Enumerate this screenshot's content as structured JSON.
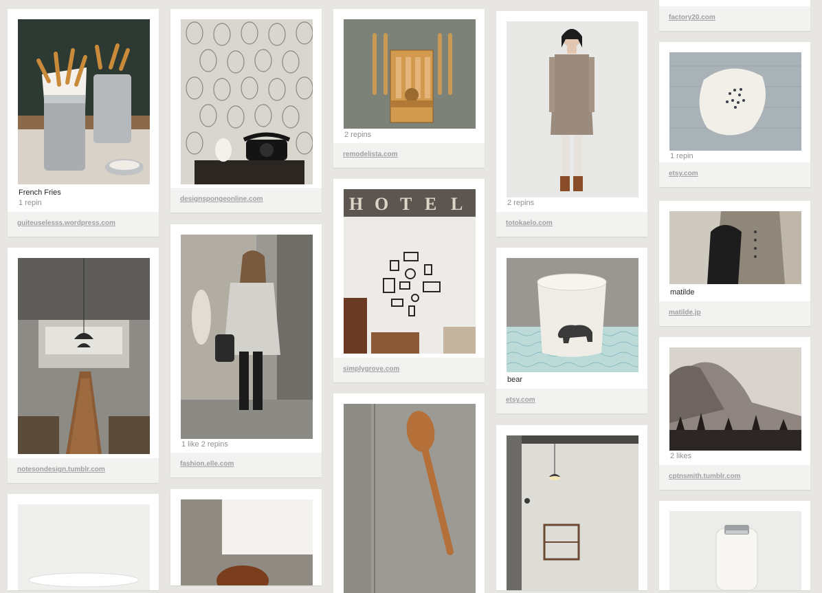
{
  "pins": {
    "french_fries": {
      "caption": "French Fries",
      "stats": "1 repin",
      "source": "guiteuselesss.wordpress.com"
    },
    "owl_wallpaper": {
      "source": "designspongeonline.com"
    },
    "long_table": {
      "source": "notesondesign.tumblr.com"
    },
    "cake": {},
    "toothbrushes": {
      "stats": "2 repins",
      "source": "remodelista.com"
    },
    "hotel_wall": {
      "source": "simplygrove.com"
    },
    "wooden_spoon": {},
    "street_fashion": {
      "stats": "1 like  2 repins",
      "source": "fashion.elle.com"
    },
    "copper_bowl": {},
    "grey_dress": {
      "stats": "2 repins",
      "source": "totokaelo.com"
    },
    "bear_cup": {
      "caption": "bear",
      "source": "etsy.com"
    },
    "shelf_room": {},
    "top_partial": {
      "source": "factory20.com"
    },
    "plate": {
      "stats": "1 repin",
      "source": "etsy.com"
    },
    "matilde": {
      "caption": "matilde",
      "source": "matilde.jp"
    },
    "mountain": {
      "stats": "2 likes",
      "source": "cptnsmith.tumblr.com"
    },
    "jar": {}
  },
  "icons": {
    "overlay": "pin-hover-overlay"
  }
}
